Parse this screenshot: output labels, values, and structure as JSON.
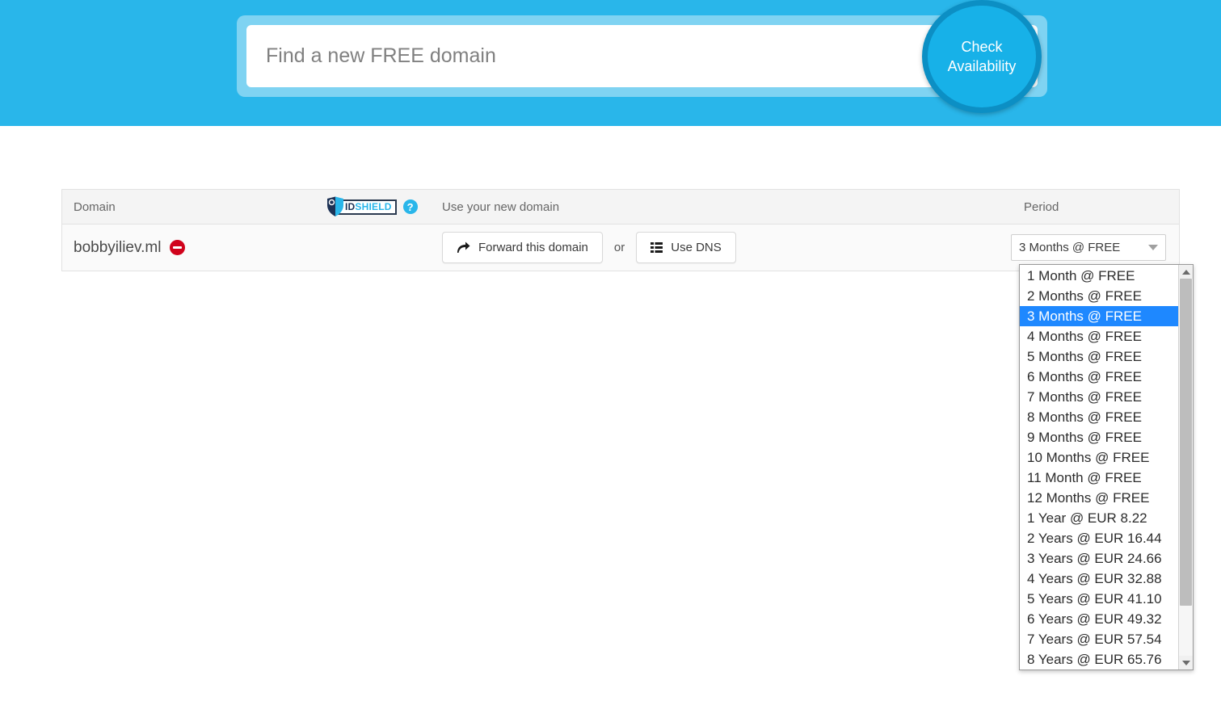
{
  "search": {
    "placeholder": "Find a new FREE domain",
    "value": "",
    "check_button_label": "Check Availability",
    "band_color": "#29b6ea",
    "frame_color": "#7fd3f2",
    "button_fill": "#17b1e8",
    "button_ring": "#0c8fc4"
  },
  "table": {
    "headers": {
      "domain": "Domain",
      "idshield_id": "ID",
      "idshield_shield": "SHIELD",
      "help_icon": "?",
      "use_domain": "Use your new domain",
      "period": "Period"
    },
    "row": {
      "domain_name": "bobbyiliev.ml",
      "status_icon": "no-entry-icon",
      "status_color": "#d0021b",
      "forward_button": "Forward this domain",
      "or_label": "or",
      "dns_button": "Use DNS",
      "period_selected": "3 Months @ FREE"
    }
  },
  "dropdown": {
    "selected_index": 2,
    "highlight_color": "#1e88ff",
    "options": [
      "1 Month @ FREE",
      "2 Months @ FREE",
      "3 Months @ FREE",
      "4 Months @ FREE",
      "5 Months @ FREE",
      "6 Months @ FREE",
      "7 Months @ FREE",
      "8 Months @ FREE",
      "9 Months @ FREE",
      "10 Months @ FREE",
      "11 Month @ FREE",
      "12 Months @ FREE",
      "1 Year @ EUR 8.22",
      "2 Years @ EUR 16.44",
      "3 Years @ EUR 24.66",
      "4 Years @ EUR 32.88",
      "5 Years @ EUR 41.10",
      "6 Years @ EUR 49.32",
      "7 Years @ EUR 57.54",
      "8 Years @ EUR 65.76"
    ]
  }
}
